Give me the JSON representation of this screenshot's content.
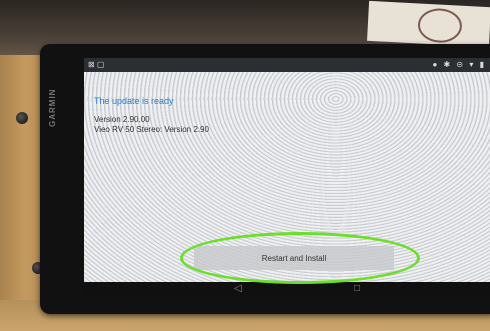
{
  "brand": "GARMIN",
  "status_bar": {
    "left_icons": "⊠ ▢",
    "right_icons": "● ✱ ⊝ ▾ ▮"
  },
  "dialog": {
    "title": "The update is ready",
    "version": "Version 2.90.00",
    "component": "Vieo RV 50 Stereo: Version 2.90"
  },
  "install_button": "Restart and Install",
  "nav": {
    "back": "◁",
    "recent": "□"
  },
  "colors": {
    "title": "#2a7fd4",
    "highlight": "#6dde2a"
  }
}
